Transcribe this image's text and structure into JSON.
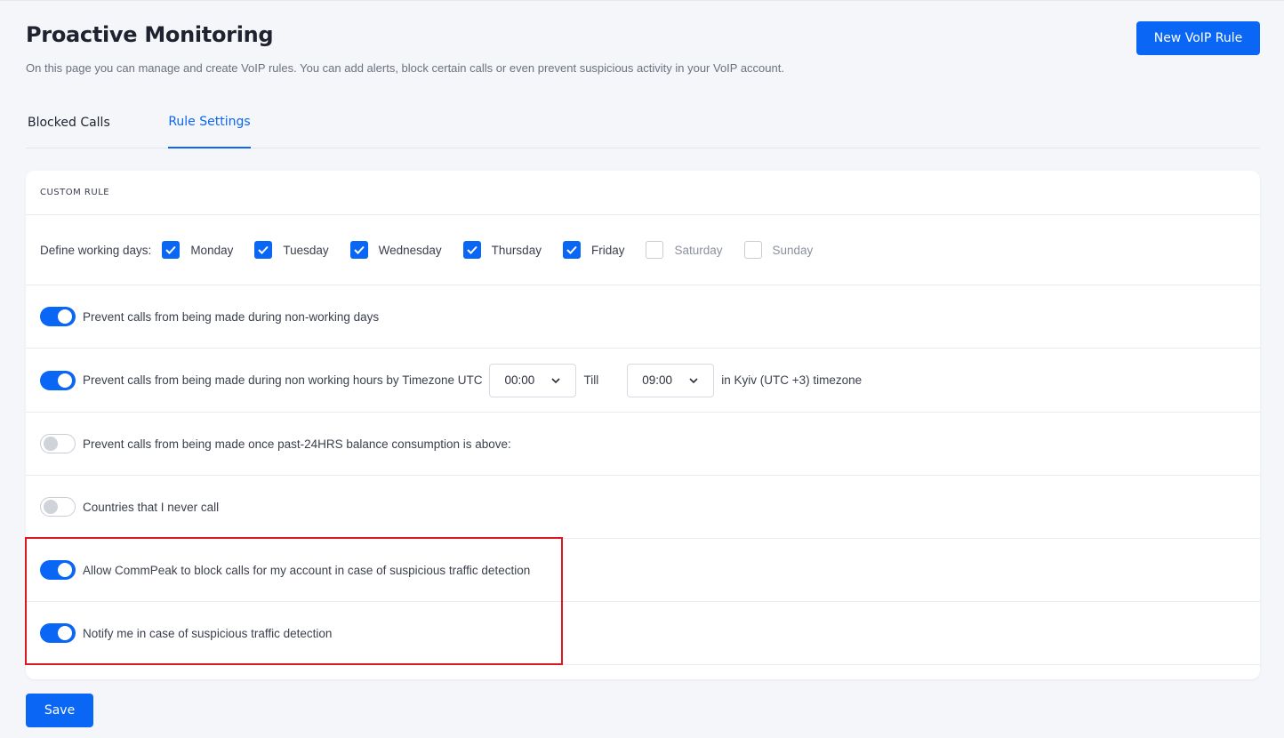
{
  "header": {
    "title": "Proactive Monitoring",
    "description": "On this page you can manage and create VoIP rules. You can add alerts, block certain calls or even prevent suspicious activity in your VoIP account.",
    "new_rule_label": "New VoIP Rule"
  },
  "tabs": [
    {
      "label": "Blocked Calls",
      "active": false
    },
    {
      "label": "Rule Settings",
      "active": true
    }
  ],
  "card": {
    "title": "CUSTOM RULE",
    "working_days_label": "Define working days:",
    "days": [
      {
        "label": "Monday",
        "checked": true
      },
      {
        "label": "Tuesday",
        "checked": true
      },
      {
        "label": "Wednesday",
        "checked": true
      },
      {
        "label": "Thursday",
        "checked": true
      },
      {
        "label": "Friday",
        "checked": true
      },
      {
        "label": "Saturday",
        "checked": false
      },
      {
        "label": "Sunday",
        "checked": false
      }
    ],
    "rules": [
      {
        "label": "Prevent calls from being made during non-working days",
        "enabled": true
      },
      {
        "label": "Prevent calls from being made during non working hours by Timezone UTC",
        "enabled": true
      },
      {
        "label": "Prevent calls from being made once past-24HRS balance consumption is above:",
        "enabled": false
      },
      {
        "label": "Countries that I never call",
        "enabled": false
      },
      {
        "label": "Allow CommPeak to block calls for my account in case of suspicious traffic detection",
        "enabled": true
      },
      {
        "label": "Notify me in case of suspicious traffic detection",
        "enabled": true
      }
    ],
    "hours": {
      "from": "00:00",
      "till_label": "Till",
      "to": "09:00",
      "timezone_note": "in Kyiv (UTC +3) timezone"
    }
  },
  "save_label": "Save",
  "colors": {
    "accent": "#0a66f5",
    "highlight": "#e0161e"
  }
}
